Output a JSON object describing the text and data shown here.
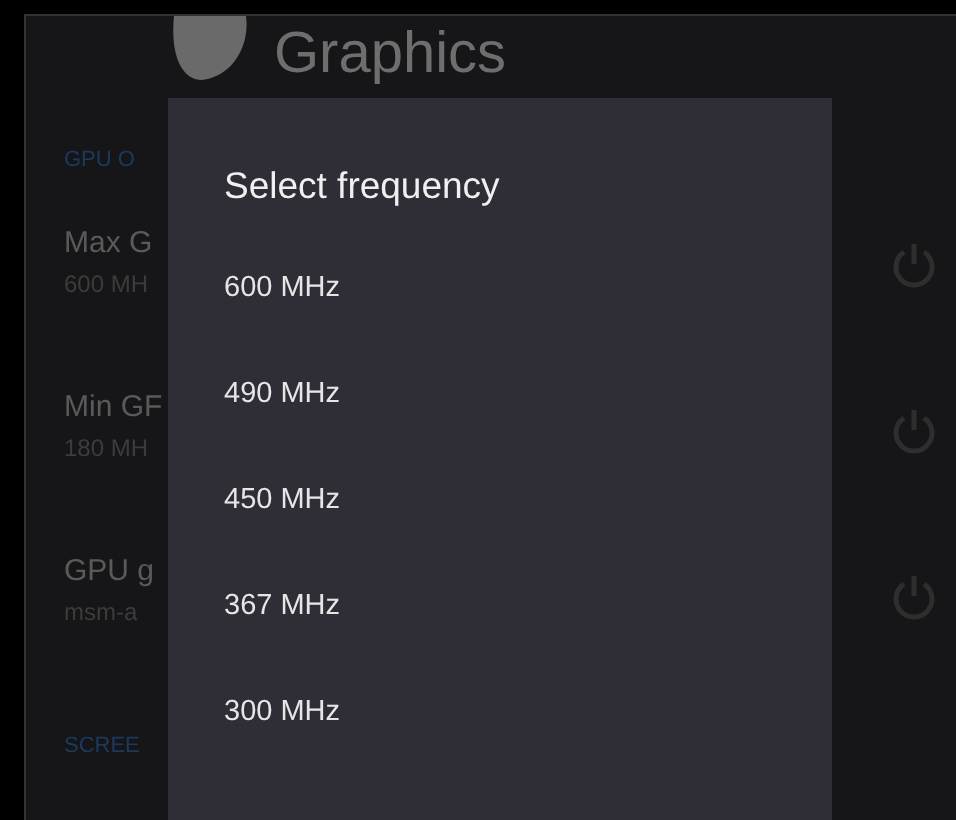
{
  "header": {
    "title": "Graphics"
  },
  "background": {
    "sections": [
      {
        "kind": "header",
        "text": "GPU O"
      },
      {
        "kind": "setting",
        "title": "Max G",
        "value": "600 MH"
      },
      {
        "kind": "setting",
        "title": "Min GF",
        "value": "180 MH"
      },
      {
        "kind": "setting",
        "title": "GPU g",
        "value": "msm-a"
      },
      {
        "kind": "header",
        "text": "SCREE"
      }
    ]
  },
  "dialog": {
    "title": "Select frequency",
    "options": [
      {
        "label": "600 MHz"
      },
      {
        "label": "490 MHz"
      },
      {
        "label": "450 MHz"
      },
      {
        "label": "367 MHz"
      },
      {
        "label": "300 MHz"
      }
    ]
  }
}
